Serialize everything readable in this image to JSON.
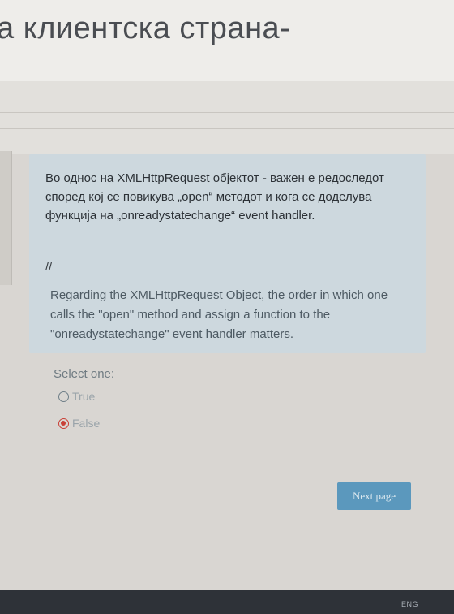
{
  "header": {
    "title": "а клиентска страна-"
  },
  "question": {
    "text_mk": "Во однос на XMLHttpRequest објектот - важен е редоследот според кој се повикува „open“ методот и кога се доделува функција на „onreadystatechange“ event handler.",
    "separator": "//",
    "text_en": "Regarding the XMLHttpRequest Object, the order in which one calls the \"open\" method and assign a function to the \"onreadystatechange\" event handler matters.",
    "select_label": "Select one:",
    "options": [
      {
        "label": "True",
        "selected": false
      },
      {
        "label": "False",
        "selected": true
      }
    ]
  },
  "navigation": {
    "next_label": "Next page"
  },
  "taskbar": {
    "language": "ENG"
  },
  "colors": {
    "question_background": "#cdd8de",
    "next_button": "#5b98bd",
    "selected_radio": "#c94037"
  }
}
